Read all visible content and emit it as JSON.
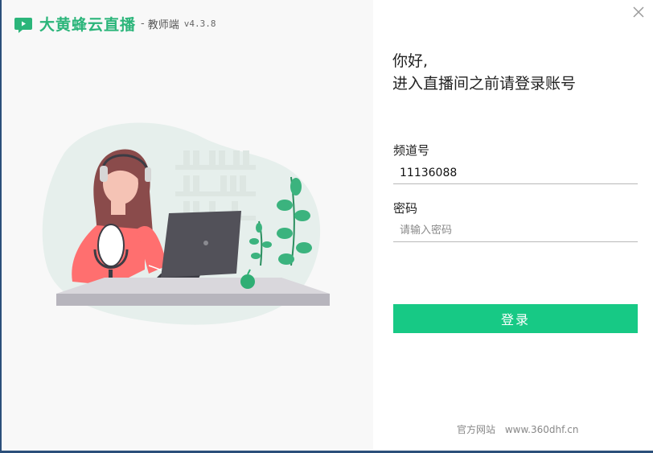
{
  "app": {
    "name": "大黄蜂云直播",
    "separator": "-",
    "role": "教师端",
    "version": "v4.3.8"
  },
  "login": {
    "greeting_line1": "你好,",
    "greeting_line2": "进入直播间之前请登录账号",
    "channel_label": "频道号",
    "channel_value": "11136088",
    "password_label": "密码",
    "password_placeholder": "请输入密码",
    "submit_label": "登录"
  },
  "footer": {
    "label": "官方网站",
    "url": "www.360dhf.cn"
  },
  "icons": {
    "logo": "chat-bubble-play-icon",
    "close": "close-icon"
  },
  "colors": {
    "brand": "#2bb57a",
    "button": "#17c985"
  }
}
